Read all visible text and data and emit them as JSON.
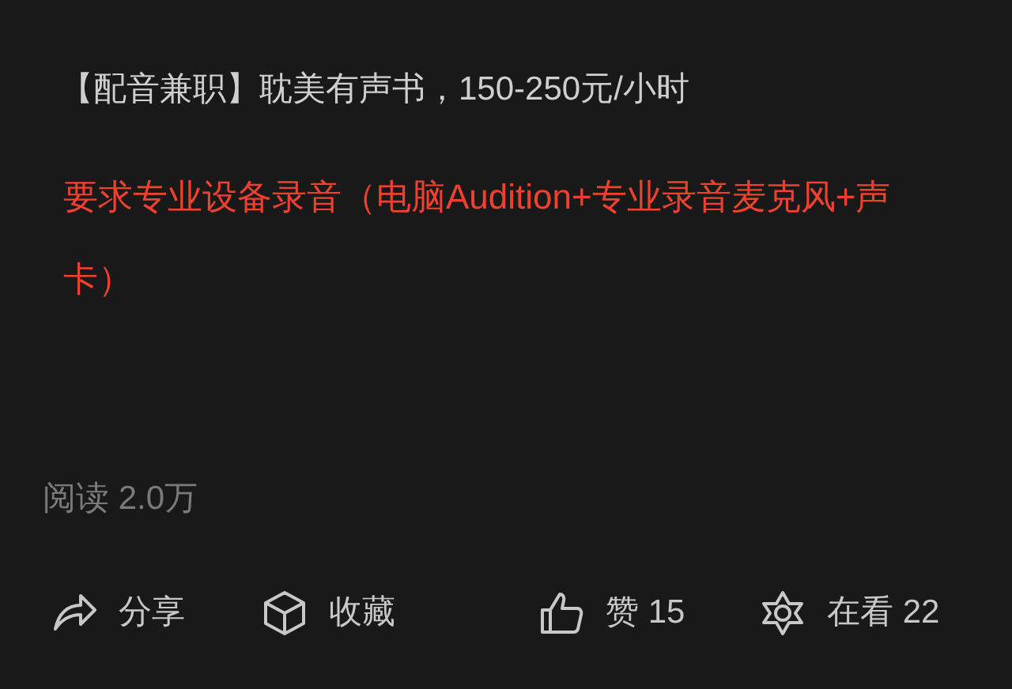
{
  "title": "【配音兼职】耽美有声书，150-250元/小时",
  "requirement": "要求专业设备录音（电脑Audition+专业录音麦克风+声卡）",
  "reads": "阅读 2.0万",
  "actions": [
    {
      "kind": "share",
      "label": "分享"
    },
    {
      "kind": "favorite",
      "label": "收藏"
    },
    {
      "kind": "like",
      "label": "赞 15"
    },
    {
      "kind": "watching",
      "label": "在看 22"
    }
  ]
}
